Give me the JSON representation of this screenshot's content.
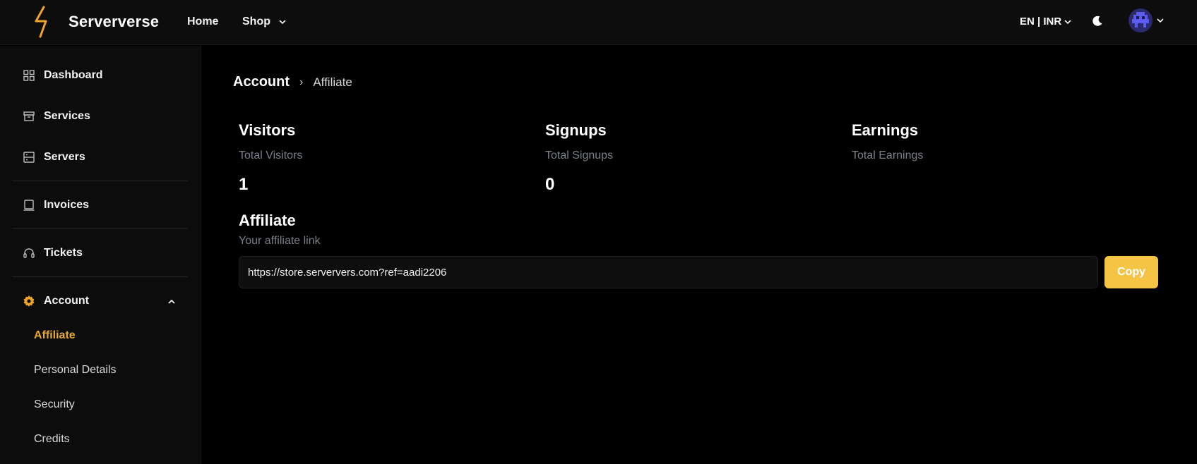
{
  "app": {
    "name": "Serververse"
  },
  "nav": {
    "home": "Home",
    "shop": "Shop"
  },
  "locale": {
    "label": "EN | INR"
  },
  "sidebar": {
    "items": [
      {
        "label": "Dashboard",
        "icon": "grid-icon"
      },
      {
        "label": "Services",
        "icon": "box-icon"
      },
      {
        "label": "Servers",
        "icon": "server-icon"
      },
      {
        "label": "Invoices",
        "icon": "invoice-icon"
      },
      {
        "label": "Tickets",
        "icon": "headset-icon"
      },
      {
        "label": "Account",
        "icon": "gear-icon"
      }
    ],
    "account_sub": [
      "Affiliate",
      "Personal Details",
      "Security",
      "Credits"
    ]
  },
  "breadcrumb": {
    "root": "Account",
    "separator": "›",
    "current": "Affiliate"
  },
  "stats": [
    {
      "title": "Visitors",
      "subtitle": "Total Visitors",
      "value": "1"
    },
    {
      "title": "Signups",
      "subtitle": "Total Signups",
      "value": "0"
    },
    {
      "title": "Earnings",
      "subtitle": "Total Earnings",
      "value": ""
    }
  ],
  "affiliate": {
    "title": "Affiliate",
    "subtitle": "Your affiliate link",
    "link": "https://store.serververs.com?ref=aadi2206",
    "copy_label": "Copy"
  },
  "colors": {
    "accent": "#f6c445",
    "active_link": "#e8a92f",
    "background": "#000000",
    "sidebar": "#0c0c0c"
  }
}
